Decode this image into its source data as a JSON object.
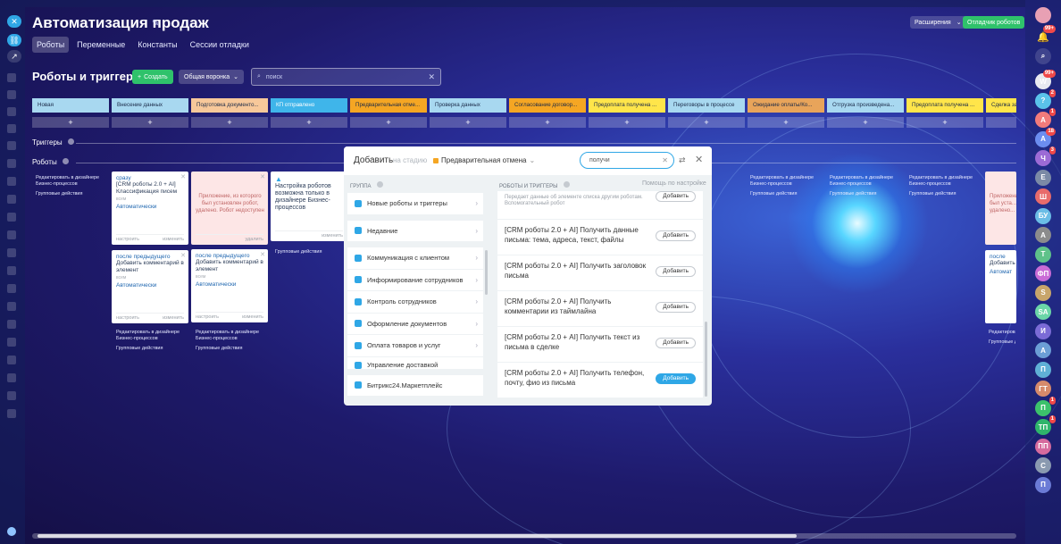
{
  "header": {
    "title": "Автоматизация продаж",
    "tabs": [
      "Роботы",
      "Переменные",
      "Константы",
      "Сессии отладки"
    ],
    "extensions_label": "Расширения",
    "debug_label": "Отладчик роботов"
  },
  "robots": {
    "title": "Роботы и триггеры",
    "create_label": "Создать",
    "funnel_label": "Общая воронка",
    "search_placeholder": "поиск"
  },
  "stages": [
    {
      "name": "Новая",
      "color": "#a8d8f0"
    },
    {
      "name": "Внесение данных",
      "color": "#a8d8f0"
    },
    {
      "name": "Подготовка документо...",
      "color": "#f7c89a"
    },
    {
      "name": "КП отправлено",
      "color": "#3fb5ea"
    },
    {
      "name": "Предварительная отме...",
      "color": "#f5a623"
    },
    {
      "name": "Проверка данных",
      "color": "#a8d8f0"
    },
    {
      "name": "Согласование договор...",
      "color": "#f5a623"
    },
    {
      "name": "Предоплата получена ...",
      "color": "#ffe54a"
    },
    {
      "name": "Переговоры в процессе",
      "color": "#a8d8f0"
    },
    {
      "name": "Ожидание оплаты/Ко...",
      "color": "#e8a45a"
    },
    {
      "name": "Отгрузка произведена...",
      "color": "#a8d8f0"
    },
    {
      "name": "Предоплата получена ...",
      "color": "#ffe54a"
    },
    {
      "name": "Сделка за...",
      "color": "#ffe54a"
    }
  ],
  "plus": "+",
  "groups": {
    "triggers": "Триггеры",
    "robots": "Роботы"
  },
  "column_links": {
    "edit": "Редактировать в дизайнере Бизнес-процессов",
    "group": "Групповые действия"
  },
  "cards": {
    "c1": {
      "cond": "сразу",
      "name": "[CRM роботы 2.0 + AI] Классификация писем",
      "hint": "всем",
      "exec": "Автоматически",
      "foot_left": "настроить",
      "foot_right": "изменить"
    },
    "c2": {
      "msg": "Приложение, из которого был установлен робот, удалено. Робот недоступен",
      "foot_right": "удалить"
    },
    "c3": {
      "msg": "Настройка роботов возможна только в дизайнере Бизнес-процессов",
      "foot_right": "изменить"
    },
    "c4": {
      "cond": "после предыдущего",
      "name": "Добавить комментарий в элемент",
      "hint": "всем",
      "exec": "Автоматически",
      "foot_left": "настроить",
      "foot_right": "изменить"
    },
    "c5": {
      "cond": "после предыдущего",
      "name": "Добавить комментарий в элемент",
      "hint": "всем",
      "exec": "Автоматически",
      "foot_left": "настроить",
      "foot_right": "изменить"
    },
    "c6": {
      "msg": "Приложени... был уста... удалено...",
      "cond": "после",
      "name": "Добавить",
      "exec": "Автомат"
    }
  },
  "dialog": {
    "title": "Добавить",
    "subtitle": "на стадию",
    "stage": "Предварительная отмена",
    "search_value": "получи",
    "group_label": "ГРУППА",
    "groups": [
      "Новые роботы и триггеры",
      "Недавние",
      "Коммуникация с клиентом",
      "Информирование сотрудников",
      "Контроль сотрудников",
      "Оформление документов",
      "Оплата товаров и услуг",
      "Управление доставкой",
      "Битрикс24.Маркетплейс"
    ],
    "robots_label": "РОБОТЫ И ТРИГГЕРЫ",
    "help": "Помощь по настройке",
    "top_item": "Передает данные об элементе списка другим роботам. Вспомогательный робот",
    "add_label": "Добавить",
    "items": [
      "[CRM роботы 2.0 + AI] Получить данные письма: тема, адреса, текст, файлы",
      "[CRM роботы 2.0 + AI] Получить заголовок письма",
      "[CRM роботы 2.0 + AI] Получить комментарии из таймлайна",
      "[CRM роботы 2.0 + AI] Получить текст из письма в сделке",
      "[CRM роботы 2.0 + AI] Получить телефон, почту, фио из письма"
    ]
  },
  "right_rail": [
    {
      "label": "W",
      "color": "#e8eaf0",
      "badge": "99+"
    },
    {
      "label": "?",
      "color": "#5ac2ea",
      "badge": "2"
    },
    {
      "label": "A",
      "color": "#f27b7b",
      "badge": "1"
    },
    {
      "label": "A",
      "color": "#6b8df0",
      "badge": "18"
    },
    {
      "label": "Ч",
      "color": "#9c6bd6",
      "badge": "3"
    },
    {
      "label": "E",
      "color": "#7b8aa6",
      "badge": ""
    },
    {
      "label": "Ш",
      "color": "#e86b6b",
      "badge": ""
    },
    {
      "label": "БУ",
      "color": "#6bbde6",
      "badge": ""
    },
    {
      "label": "A",
      "color": "#8c8c8c",
      "badge": ""
    },
    {
      "label": "T",
      "color": "#5fc28a",
      "badge": ""
    },
    {
      "label": "ФП",
      "color": "#c96bd6",
      "badge": ""
    },
    {
      "label": "S",
      "color": "#c8a56b",
      "badge": ""
    },
    {
      "label": "SA",
      "color": "#6bd6a8",
      "badge": ""
    },
    {
      "label": "И",
      "color": "#7b6bd6",
      "badge": ""
    },
    {
      "label": "А",
      "color": "#6b9ed6",
      "badge": ""
    },
    {
      "label": "П",
      "color": "#5fb0d6",
      "badge": ""
    },
    {
      "label": "ГТ",
      "color": "#d68a6b",
      "badge": ""
    },
    {
      "label": "П",
      "color": "#3cc26b",
      "badge": "1"
    },
    {
      "label": "ТП",
      "color": "#2fb56b",
      "badge": "1"
    },
    {
      "label": "ПП",
      "color": "#d66b9e",
      "badge": ""
    },
    {
      "label": "C",
      "color": "#8a9ab0",
      "badge": ""
    },
    {
      "label": "П",
      "color": "#6b7bd6",
      "badge": ""
    }
  ]
}
